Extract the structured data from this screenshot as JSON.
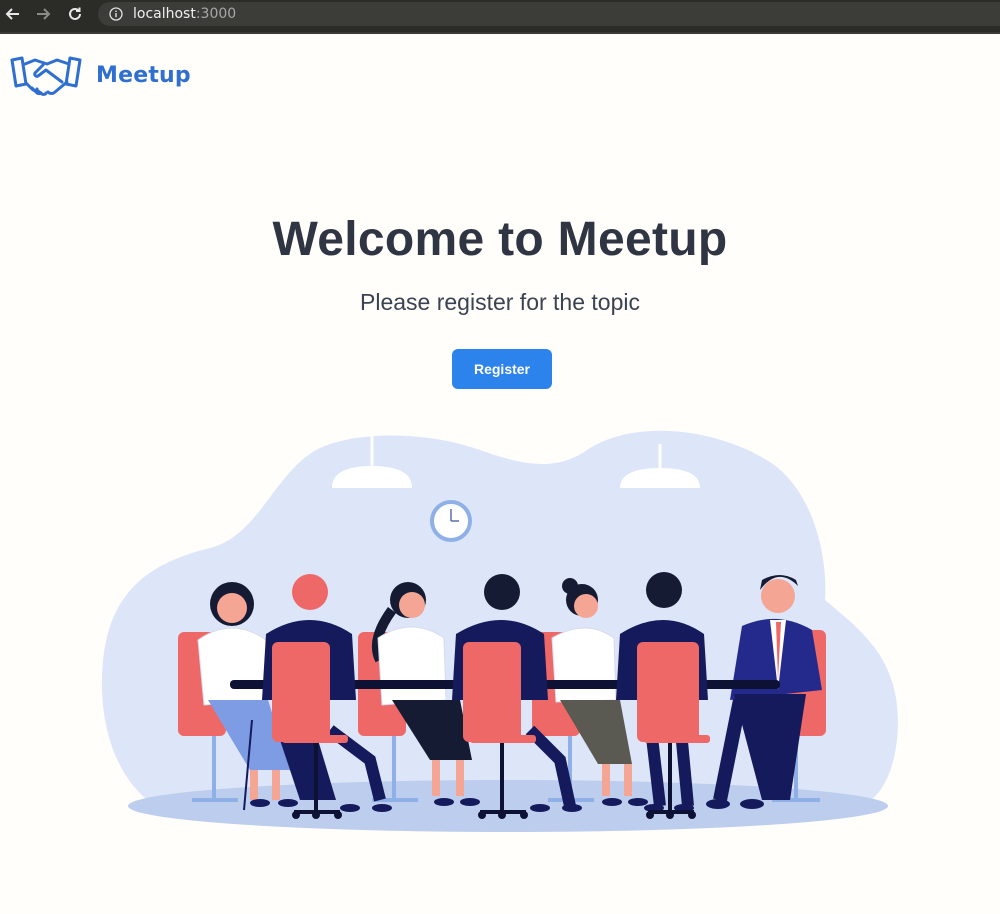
{
  "browser": {
    "url_host": "localhost",
    "url_port": ":3000"
  },
  "header": {
    "brand": "Meetup",
    "logo_icon": "handshake-icon"
  },
  "hero": {
    "title": "Welcome to Meetup",
    "subtitle": "Please register for the topic",
    "register_label": "Register"
  },
  "colors": {
    "accent": "#2d83ec",
    "brand": "#2f6fd1",
    "title": "#2f3542",
    "background": "#fffefa",
    "illustration_blob": "#dde6f8",
    "chair": "#ef6868",
    "navy": "#141a5c"
  }
}
